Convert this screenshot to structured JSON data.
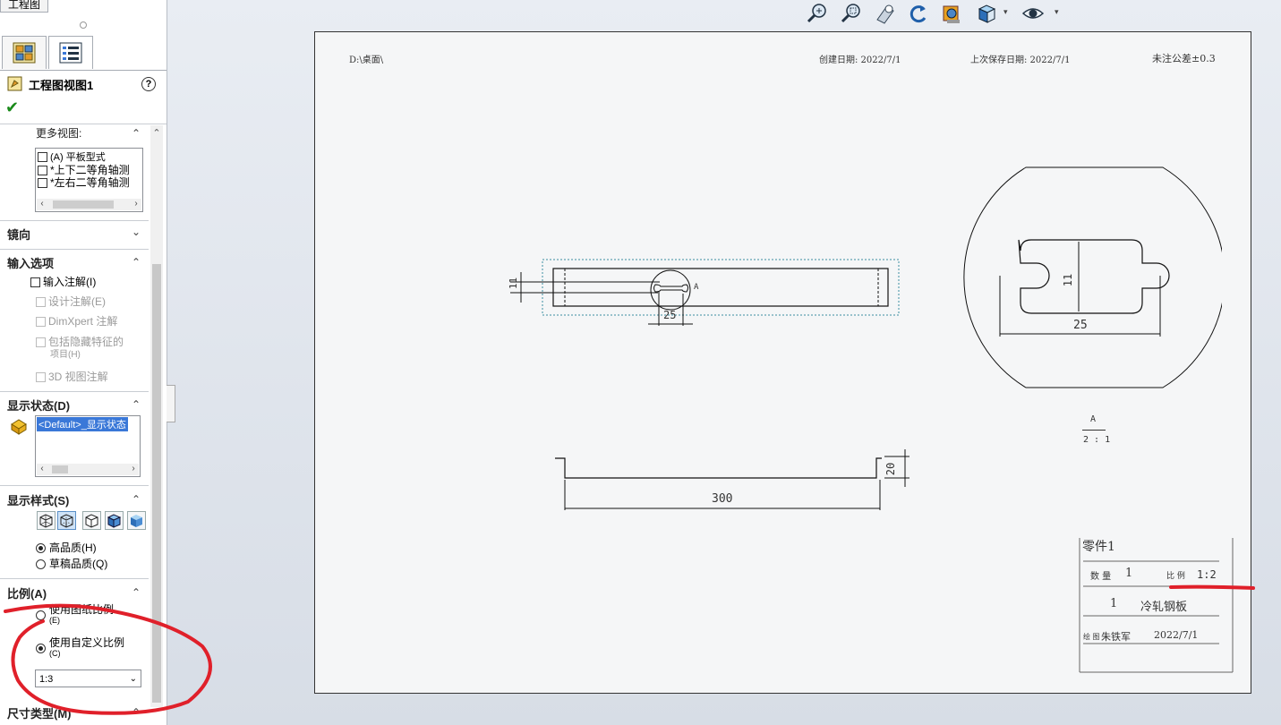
{
  "top_tab": "工程图",
  "property_manager": {
    "title": "工程图视图1",
    "help_icon_text": "?",
    "more_views": {
      "heading": "更多视图:",
      "items": [
        {
          "label": "(A) 平板型式",
          "checked": false
        },
        {
          "label": "*上下二等角轴测",
          "checked": false
        },
        {
          "label": "*左右二等角轴测",
          "checked": false
        }
      ]
    },
    "mirror": {
      "heading": "镜向"
    },
    "import_options": {
      "heading": "输入选项",
      "import_annotations": "输入注解(I)",
      "design_annotations": "设计注解(E)",
      "dimxpert_annotations": "DimXpert 注解",
      "hidden_feature_items_line1": "包括隐藏特征的",
      "hidden_feature_items_line2": "项目(H)",
      "view_3d_annotations": "3D 视图注解"
    },
    "display_state": {
      "heading": "显示状态(D)",
      "selected": "<Default>_显示状态"
    },
    "display_style": {
      "heading": "显示样式(S)",
      "high_quality": "高品质(H)",
      "draft_quality": "草稿品质(Q)",
      "selected_quality": "high"
    },
    "scale": {
      "heading": "比例(A)",
      "use_sheet_scale_line1": "使用图纸比例",
      "use_sheet_scale_line2": "(E)",
      "use_custom_scale_line1": "使用自定义比例",
      "use_custom_scale_line2": "(C)",
      "custom_scale_value": "1:3",
      "selected": "custom"
    },
    "dimension_type": {
      "heading": "尺寸类型(M)"
    }
  },
  "drawing_sheet": {
    "path_label": "D:\\桌面\\",
    "created_label": "创建日期: 2022/7/1",
    "saved_label": "上次保存日期: 2022/7/1",
    "tolerance_label": "未注公差±0.3",
    "detail_label": "A",
    "detail_callout": "A",
    "detail_scale": "2 : 1",
    "dimensions": {
      "front_width": "25",
      "front_height": "11",
      "detail_width": "25",
      "detail_height": "11",
      "bottom_length": "300",
      "bottom_height": "20"
    },
    "title_block": {
      "part_name": "零件1",
      "quantity_label": "数 量",
      "quantity_value": "1",
      "scale_label": "比 例",
      "scale_value": "1:2",
      "material_index": "1",
      "material": "冷轧钢板",
      "drawer_label": "绘 图",
      "drawer_name": "朱铁军",
      "date": "2022/7/1"
    }
  },
  "colors": {
    "annotation_red": "#e0202a",
    "selection_blue": "#3a78d8",
    "view_border_teal": "#3a8ea0"
  }
}
